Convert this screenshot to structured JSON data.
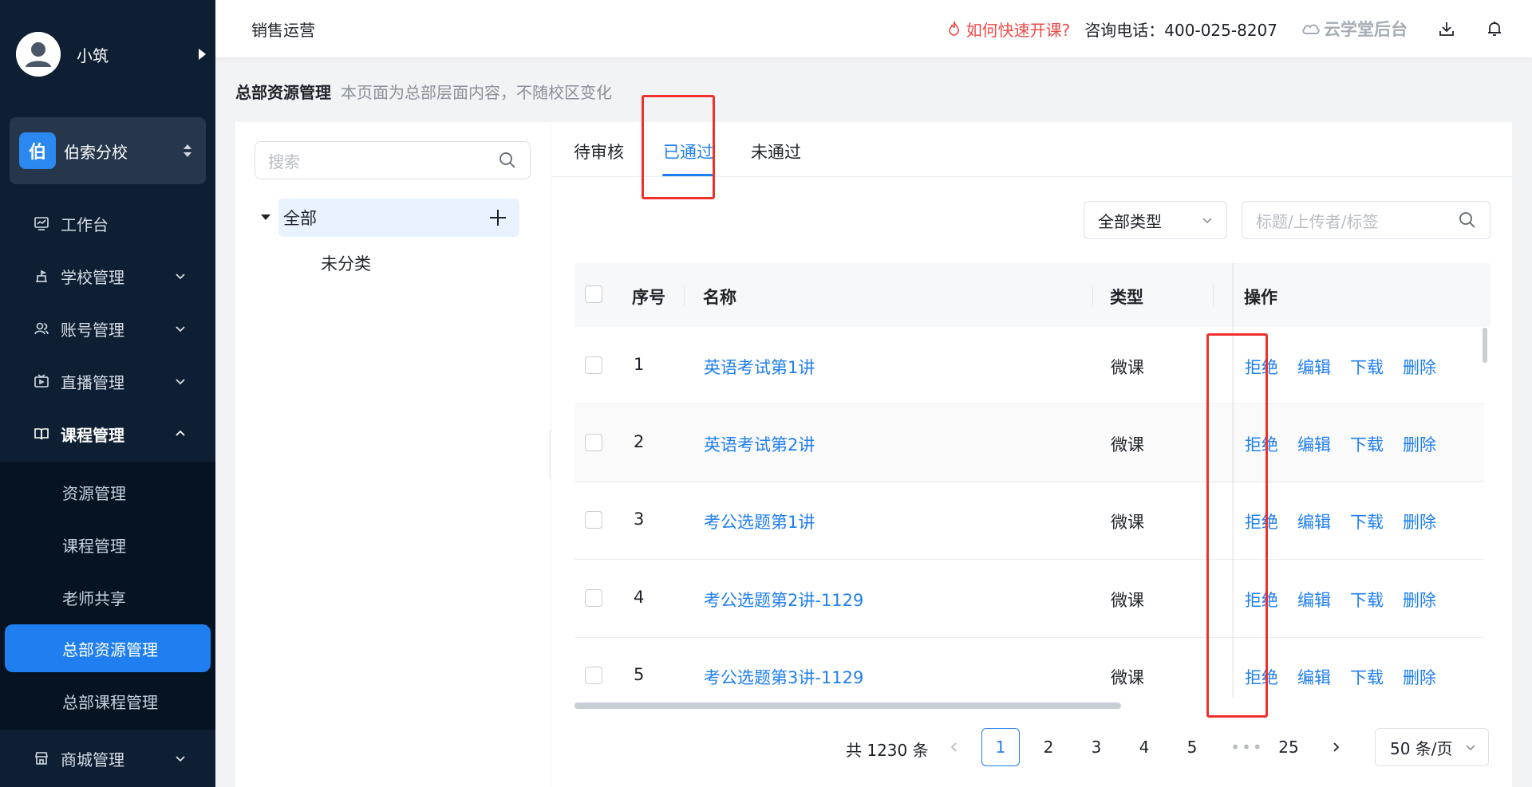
{
  "sidebar": {
    "user_name": "小筑",
    "school_badge": "伯",
    "school_name": "伯索分校",
    "items": [
      {
        "label": "工作台"
      },
      {
        "label": "学校管理"
      },
      {
        "label": "账号管理"
      },
      {
        "label": "直播管理"
      },
      {
        "label": "课程管理"
      },
      {
        "label": "商城管理"
      }
    ],
    "submenu": [
      {
        "label": "资源管理"
      },
      {
        "label": "课程管理"
      },
      {
        "label": "老师共享"
      },
      {
        "label": "总部资源管理"
      },
      {
        "label": "总部课程管理"
      }
    ],
    "active_submenu": "总部资源管理"
  },
  "header": {
    "title": "销售运营",
    "help_link": "如何快速开课?",
    "phone": "咨询电话：400-025-8207",
    "brand": "云学堂后台"
  },
  "page": {
    "title": "总部资源管理",
    "description": "本页面为总部层面内容，不随校区变化"
  },
  "tree": {
    "search_placeholder": "搜索",
    "root": "全部",
    "child": "未分类"
  },
  "tabs": [
    {
      "label": "待审核"
    },
    {
      "label": "已通过"
    },
    {
      "label": "未通过"
    }
  ],
  "active_tab": "已通过",
  "filters": {
    "type_value": "全部类型",
    "search_placeholder": "标题/上传者/标签"
  },
  "table": {
    "columns": {
      "index": "序号",
      "name": "名称",
      "type": "类型",
      "actions": "操作"
    },
    "actions": [
      "拒绝",
      "编辑",
      "下载",
      "删除"
    ],
    "rows": [
      {
        "index": "1",
        "name": "英语考试第1讲",
        "type": "微课"
      },
      {
        "index": "2",
        "name": "英语考试第2讲",
        "type": "微课"
      },
      {
        "index": "3",
        "name": "考公选题第1讲",
        "type": "微课"
      },
      {
        "index": "4",
        "name": "考公选题第2讲-1129",
        "type": "微课"
      },
      {
        "index": "5",
        "name": "考公选题第3讲-1129",
        "type": "微课"
      }
    ]
  },
  "pagination": {
    "total": "共 1230 条",
    "pages": [
      "1",
      "2",
      "3",
      "4",
      "5"
    ],
    "dots": "•••",
    "last": "25",
    "current": "1",
    "page_size": "50 条/页"
  },
  "colors": {
    "accent": "#1f7ff0",
    "sidebar_bg": "#0f1f33",
    "highlight": "#f0302c",
    "danger_link": "#f04a4a"
  }
}
